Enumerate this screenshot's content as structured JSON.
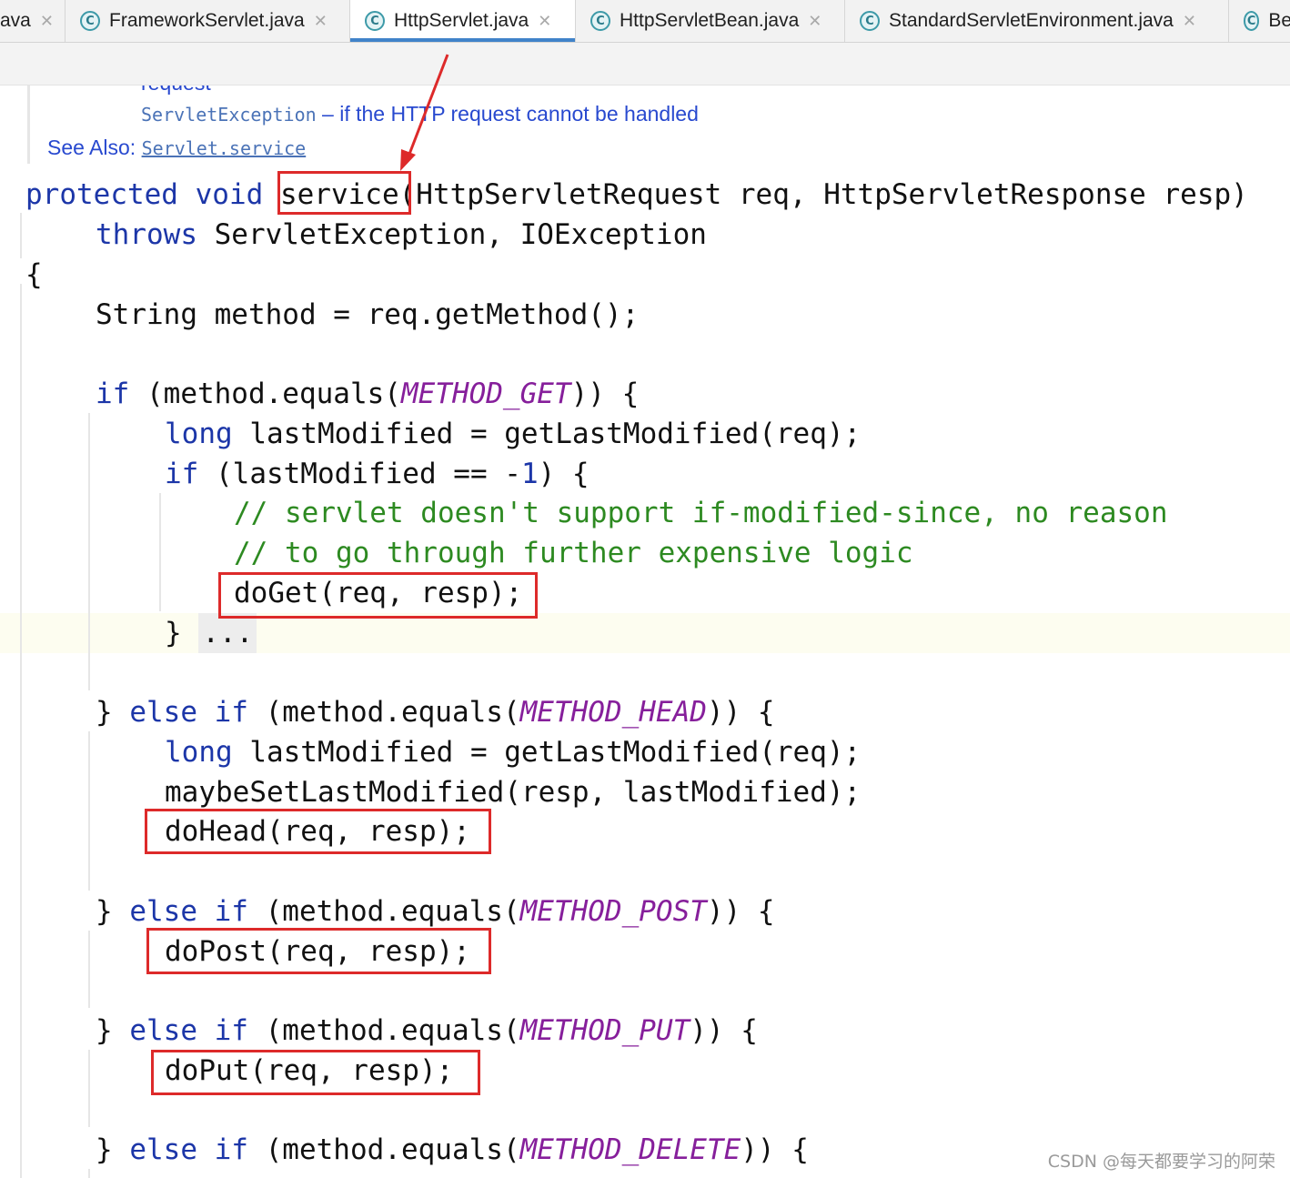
{
  "tabs": [
    {
      "name": "ava",
      "icon": "java-class-icon"
    },
    {
      "name": "FrameworkServlet.java",
      "icon": "java-class-icon"
    },
    {
      "name": "HttpServlet.java",
      "icon": "java-class-icon",
      "active": true
    },
    {
      "name": "HttpServletBean.java",
      "icon": "java-class-icon"
    },
    {
      "name": "StandardServletEnvironment.java",
      "icon": "java-class-icon"
    },
    {
      "name": "Be",
      "icon": "java-class-icon"
    }
  ],
  "tab_icon_letter": "C",
  "tab_close_glyph": "✕",
  "javadoc": {
    "cut_line": "request",
    "throws_type": "ServletException",
    "throws_text": " – if the HTTP request cannot be handled",
    "see_also_label": "See Also: ",
    "see_also_link": "Servlet.service"
  },
  "code": {
    "l1_kw": "protected void ",
    "l1_method": "service",
    "l1_rest": "(HttpServletRequest req, HttpServletResponse resp)",
    "l2_kw": "throws",
    "l2_rest": " ServletException, IOException",
    "l3": "{",
    "l4": "String method = req.getMethod();",
    "l5_kw": "if",
    "l5_a": " (method.equals(",
    "l5_const": "METHOD_GET",
    "l5_b": ")) {",
    "l6_kw": "long",
    "l6_rest": " lastModified = getLastModified(req);",
    "l7_kw": "if",
    "l7_a": " (lastModified == -",
    "l7_num": "1",
    "l7_b": ") {",
    "l8": "// servlet doesn't support if-modified-since, no reason",
    "l9": "// to go through further expensive logic",
    "l10": "doGet(req, resp);",
    "l11_brace": "} ",
    "l11_fold": "...",
    "l12_a": "} ",
    "l12_kw": "else if",
    "l12_b": " (method.equals(",
    "l12_const": "METHOD_HEAD",
    "l12_c": ")) {",
    "l13_kw": "long",
    "l13_rest": " lastModified = getLastModified(req);",
    "l14": "maybeSetLastModified(resp, lastModified);",
    "l15": "doHead(req, resp);",
    "l16_a": "} ",
    "l16_kw": "else if",
    "l16_b": " (method.equals(",
    "l16_const": "METHOD_POST",
    "l16_c": ")) {",
    "l17": "doPost(req, resp);",
    "l18_a": "} ",
    "l18_kw": "else if",
    "l18_b": " (method.equals(",
    "l18_const": "METHOD_PUT",
    "l18_c": ")) {",
    "l19": "doPut(req, resp);",
    "l20_a": "} ",
    "l20_kw": "else if",
    "l20_b": " (method.equals(",
    "l20_const": "METHOD_DELETE",
    "l20_c": ")) {"
  },
  "watermark": "CSDN @每天都要学习的阿荣",
  "colors": {
    "keyword": "#1c36a8",
    "constant": "#861f9b",
    "comment": "#2d8a21",
    "annotation_red": "#dd2a2a",
    "active_tab_underline": "#4083c9"
  }
}
